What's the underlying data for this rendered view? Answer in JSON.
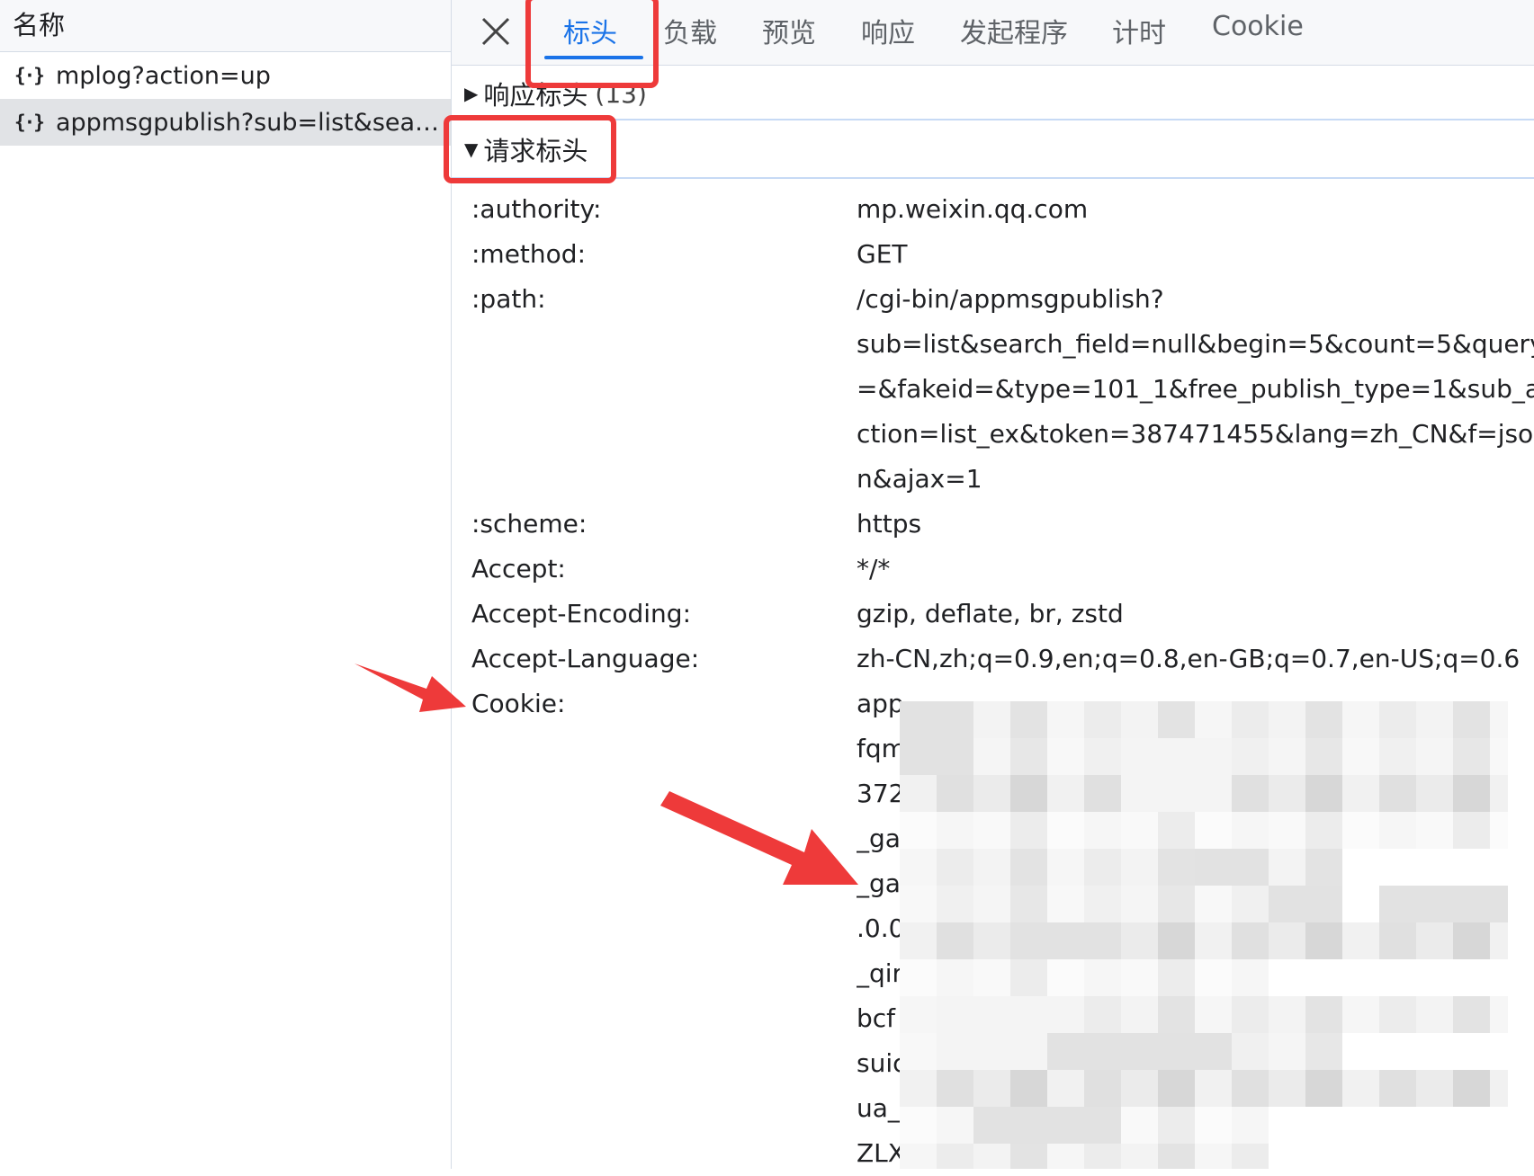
{
  "left_panel": {
    "header": "名称",
    "requests": [
      {
        "icon": "{·}",
        "name": "mplog?action=up"
      },
      {
        "icon": "{·}",
        "name": "appmsgpublish?sub=list&sear..."
      }
    ]
  },
  "tabs": [
    "标头",
    "负载",
    "预览",
    "响应",
    "发起程序",
    "计时",
    "Cookie"
  ],
  "active_tab": "标头",
  "sections": {
    "response_headers": {
      "title": "响应标头",
      "count": "(13)",
      "expanded": false
    },
    "request_headers": {
      "title": "请求标头",
      "expanded": true
    }
  },
  "request_headers": [
    {
      "key": ":authority:",
      "value_lines": [
        "mp.weixin.qq.com"
      ]
    },
    {
      "key": ":method:",
      "value_lines": [
        "GET"
      ]
    },
    {
      "key": ":path:",
      "value_lines": [
        "/cgi-bin/appmsgpublish?",
        "sub=list&search_field=null&begin=5&count=5&query",
        "=&fakeid=&type=101_1&free_publish_type=1&sub_a",
        "ction=list_ex&token=387471455&lang=zh_CN&f=jso",
        "n&ajax=1"
      ]
    },
    {
      "key": ":scheme:",
      "value_lines": [
        "https"
      ]
    },
    {
      "key": "Accept:",
      "value_lines": [
        "*/*"
      ]
    },
    {
      "key": "Accept-Encoding:",
      "value_lines": [
        "gzip, deflate, br, zstd"
      ]
    },
    {
      "key": "Accept-Language:",
      "value_lines": [
        "zh-CN,zh;q=0.9,en;q=0.8,en-GB;q=0.7,en-US;q=0.6"
      ]
    },
    {
      "key": "Cookie:",
      "value_lines": [
        "app",
        "fqm",
        "372",
        "_ga",
        "_ga",
        ".0.0",
        "_qir",
        "bcf",
        "suic",
        "ua_",
        "ZLX"
      ]
    }
  ],
  "colors": {
    "accent": "#1a73e8",
    "annotation": "#ee3a3a"
  }
}
